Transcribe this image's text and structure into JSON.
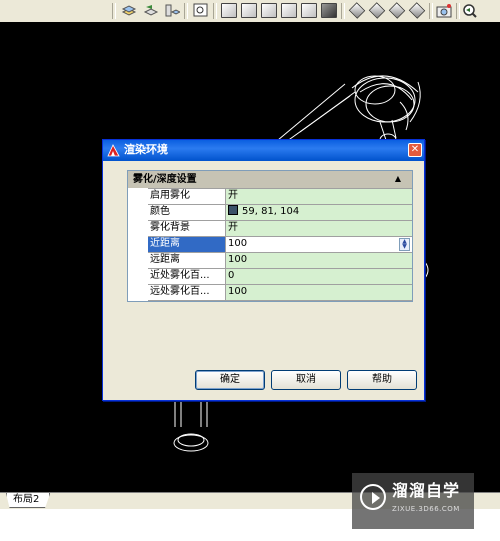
{
  "toolbar": {
    "icons": [
      "layer-icon",
      "layer-previous-icon",
      "layer-states-icon",
      "zoom-window-icon",
      "view-top-icon",
      "view-bottom-icon",
      "view-left-icon",
      "view-right-icon",
      "view-front-icon",
      "view-back-icon",
      "view-sw-iso-icon",
      "view-se-iso-icon",
      "view-ne-iso-icon",
      "view-nw-iso-icon",
      "camera-icon",
      "zoom-previous-icon"
    ]
  },
  "layout_tabs": {
    "layout2_label": "布局2"
  },
  "dialog": {
    "title": "渲染环境",
    "close_symbol": "✕",
    "category": {
      "title": "雾化/深度设置",
      "collapse_symbol": "▲"
    },
    "properties": [
      {
        "name": "启用雾化",
        "value": "开"
      },
      {
        "name": "颜色",
        "value": "59, 81, 104",
        "swatch_color": "#3b5168"
      },
      {
        "name": "雾化背景",
        "value": "开"
      },
      {
        "name": "近距离",
        "value": "100",
        "selected": true
      },
      {
        "name": "远距离",
        "value": "100"
      },
      {
        "name": "近处雾化百...",
        "value": "0"
      },
      {
        "name": "远处雾化百...",
        "value": "100"
      }
    ],
    "buttons": {
      "ok": "确定",
      "cancel": "取消",
      "help": "帮助"
    }
  },
  "watermark": {
    "name": "溜溜自学",
    "url": "ZIXUE.3D66.COM"
  }
}
